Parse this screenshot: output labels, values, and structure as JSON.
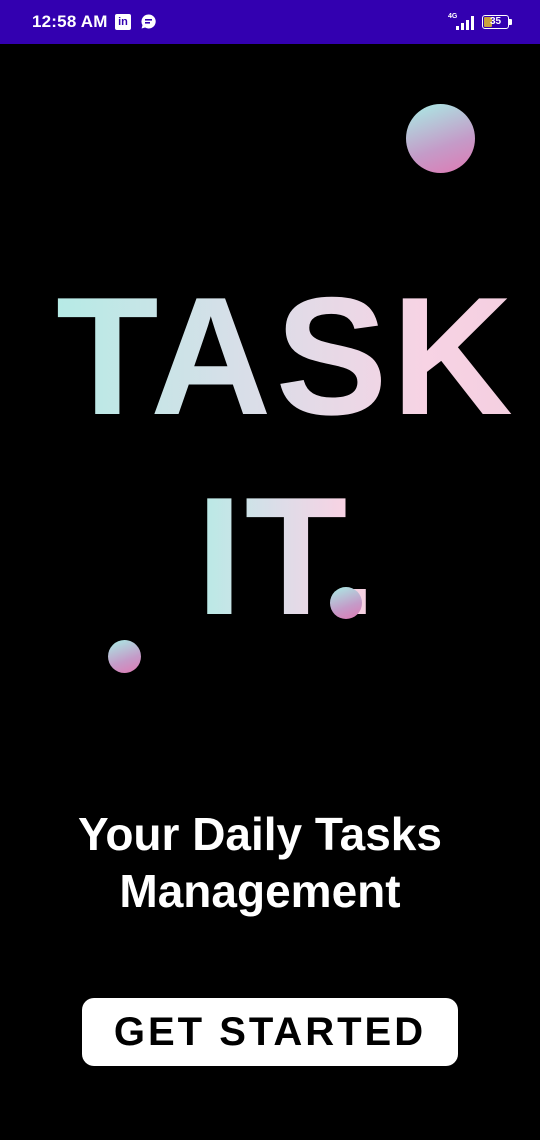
{
  "status_bar": {
    "time": "12:58 AM",
    "network": "4G",
    "battery_level": "35",
    "battery_fraction": 0.35,
    "icons": [
      "linkedin-icon",
      "chat-icon",
      "signal-icon",
      "battery-icon"
    ]
  },
  "logo": {
    "line1": "TASK",
    "line2": "IT."
  },
  "tagline": {
    "line1": "Your Daily Tasks",
    "line2": "Management"
  },
  "cta": {
    "label": "GET STARTED"
  },
  "colors": {
    "status_bar": "#3300b0",
    "background": "#000000",
    "gradient_start": "#a9eee6",
    "gradient_end": "#df79b3",
    "button": "#ffffff"
  }
}
